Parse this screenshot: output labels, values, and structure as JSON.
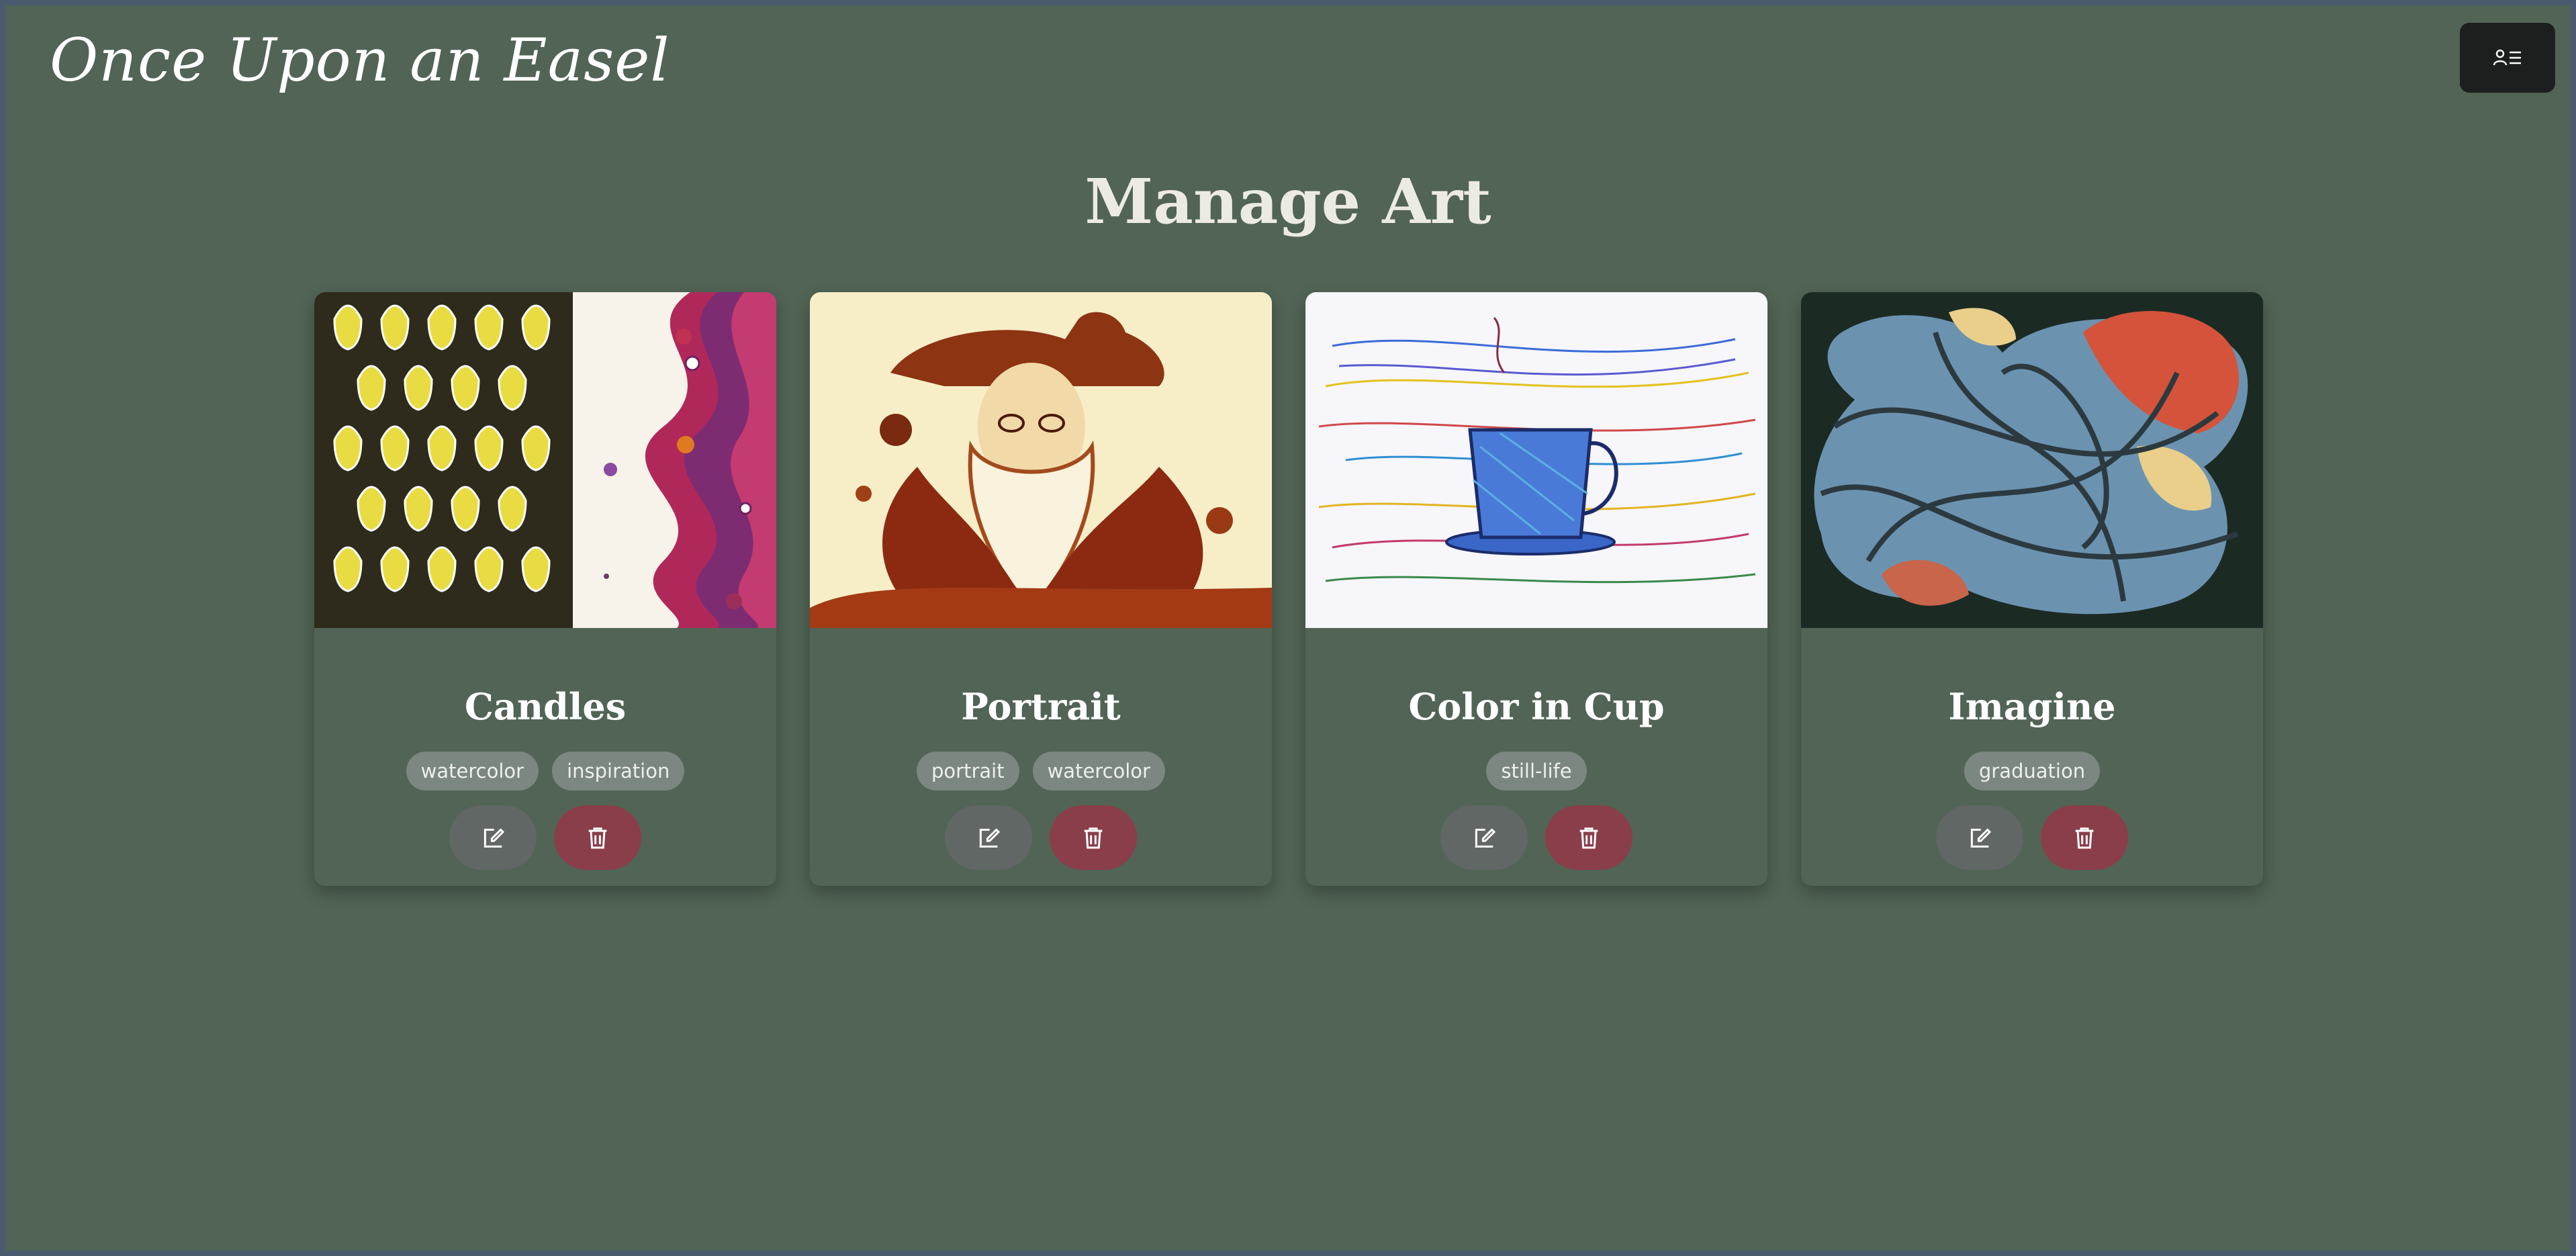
{
  "app": {
    "brand": "Once Upon an Easel"
  },
  "header": {
    "menu_icon": "user-menu-icon"
  },
  "page": {
    "title": "Manage Art"
  },
  "colors": {
    "background": "#516455",
    "edit_button": "#616764",
    "delete_button": "#8a3e4a",
    "tag": "#7b8780"
  },
  "cards": [
    {
      "title": "Candles",
      "tags": [
        "watercolor",
        "inspiration"
      ],
      "image": "candles-artwork"
    },
    {
      "title": "Portrait",
      "tags": [
        "portrait",
        "watercolor"
      ],
      "image": "portrait-artwork"
    },
    {
      "title": "Color in Cup",
      "tags": [
        "still-life"
      ],
      "image": "color-in-cup-artwork"
    },
    {
      "title": "Imagine",
      "tags": [
        "graduation"
      ],
      "image": "imagine-artwork"
    }
  ],
  "actions": {
    "edit_icon": "edit-icon",
    "delete_icon": "trash-icon"
  }
}
